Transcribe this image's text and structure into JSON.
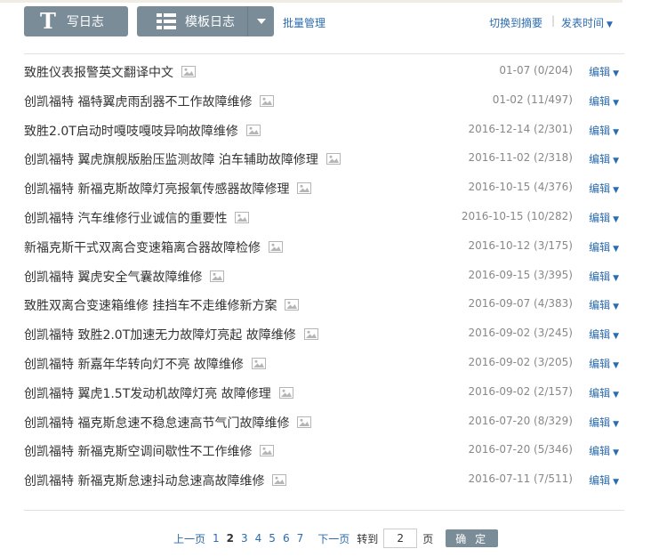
{
  "toolbar": {
    "write_label": "写日志",
    "write_icon": "T",
    "template_label": "模板日志",
    "batch_label": "批量管理",
    "switch_label": "切换到摘要",
    "separator": "|",
    "sort_label": "发表时间"
  },
  "list": {
    "edit_label": "编辑",
    "items": [
      {
        "title": "致胜仪表报警英文翻译中文",
        "date": "01-07",
        "stats": "(0/204)"
      },
      {
        "title": "创凯福特 福特翼虎雨刮器不工作故障维修",
        "date": "01-02",
        "stats": "(11/497)"
      },
      {
        "title": "致胜2.0T启动时嘎吱嘎吱异响故障维修",
        "date": "2016-12-14",
        "stats": "(2/301)"
      },
      {
        "title": "创凯福特 翼虎旗舰版胎压监测故障 泊车辅助故障修理",
        "date": "2016-11-02",
        "stats": "(2/318)"
      },
      {
        "title": "创凯福特 新福克斯故障灯亮报氧传感器故障修理",
        "date": "2016-10-15",
        "stats": "(4/376)"
      },
      {
        "title": "创凯福特 汽车维修行业诚信的重要性",
        "date": "2016-10-15",
        "stats": "(10/282)"
      },
      {
        "title": "新福克斯干式双离合变速箱离合器故障检修",
        "date": "2016-10-12",
        "stats": "(3/175)"
      },
      {
        "title": "创凯福特 翼虎安全气囊故障维修",
        "date": "2016-09-15",
        "stats": "(3/395)"
      },
      {
        "title": "致胜双离合变速箱维修 挂挡车不走维修新方案",
        "date": "2016-09-07",
        "stats": "(4/383)"
      },
      {
        "title": "创凯福特 致胜2.0T加速无力故障灯亮起 故障维修",
        "date": "2016-09-02",
        "stats": "(3/245)"
      },
      {
        "title": "创凯福特 新嘉年华转向灯不亮 故障维修",
        "date": "2016-09-02",
        "stats": "(3/205)"
      },
      {
        "title": "创凯福特 翼虎1.5T发动机故障灯亮 故障修理",
        "date": "2016-09-02",
        "stats": "(2/157)"
      },
      {
        "title": "创凯福特 福克斯怠速不稳怠速高节气门故障维修",
        "date": "2016-07-20",
        "stats": "(8/329)"
      },
      {
        "title": "创凯福特 新福克斯空调间歇性不工作维修",
        "date": "2016-07-20",
        "stats": "(5/346)"
      },
      {
        "title": "创凯福特 新福克斯怠速抖动怠速高故障维修",
        "date": "2016-07-11",
        "stats": "(7/511)"
      }
    ]
  },
  "pager": {
    "prev_label": "上一页",
    "pages": [
      "1",
      "2",
      "3",
      "4",
      "5",
      "6",
      "7"
    ],
    "current": "2",
    "next_label": "下一页",
    "goto_label": "转到",
    "page_value": "2",
    "page_unit": "页",
    "confirm_label": "确 定"
  },
  "colors": {
    "button_bg": "#7b8c99",
    "link": "#2b6cb0",
    "meta": "#888888"
  },
  "icons": {
    "write": "text-T-icon",
    "template": "template-grid-icon",
    "dropdown": "caret-down-icon",
    "image": "image-icon"
  }
}
